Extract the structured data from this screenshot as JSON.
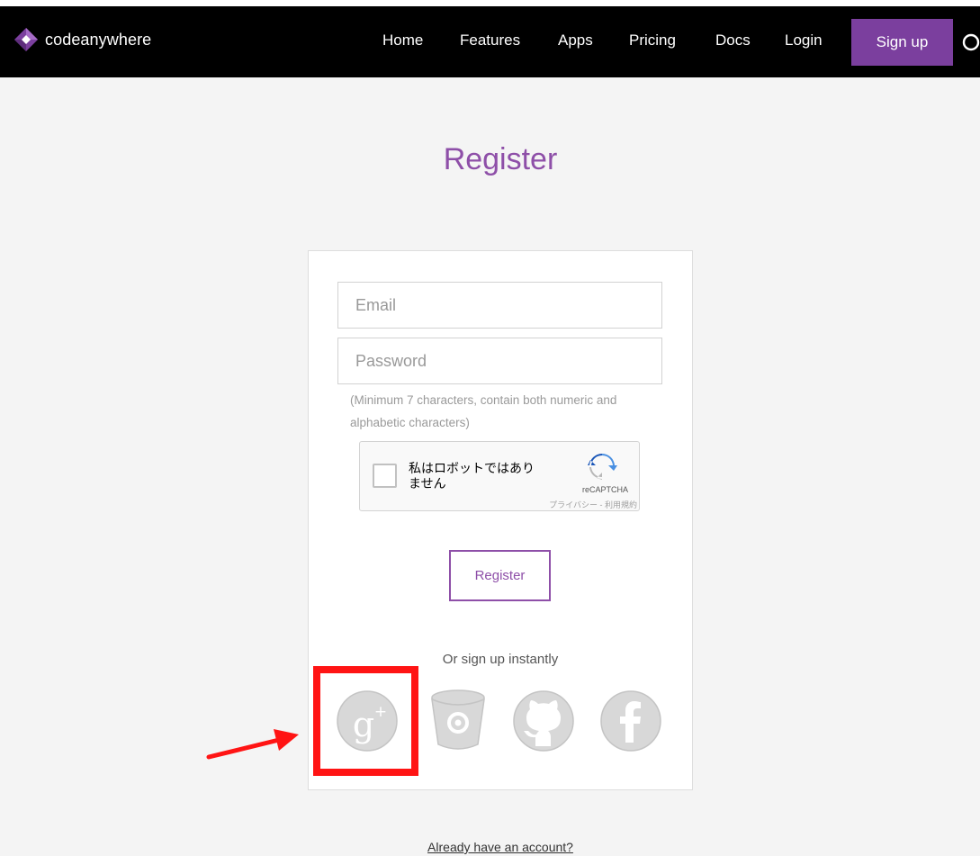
{
  "brand": {
    "name": "codeanywhere",
    "logo_icon": "diamond-logo-icon",
    "accent_color": "#7b3f9e"
  },
  "nav": {
    "items": [
      {
        "label": "Home"
      },
      {
        "label": "Features"
      },
      {
        "label": "Apps"
      },
      {
        "label": "Pricing"
      },
      {
        "label": "Docs"
      },
      {
        "label": "Login"
      }
    ],
    "signup_label": "Sign up",
    "search_icon": "search-icon"
  },
  "page": {
    "title": "Register",
    "title_color": "#8e4fa8"
  },
  "form": {
    "email_placeholder": "Email",
    "password_placeholder": "Password",
    "password_hint": "(Minimum 7 characters, contain both numeric and alphabetic characters)",
    "captcha": {
      "label": "私はロボットではありません",
      "brand": "reCAPTCHA",
      "links": "プライバシー - 利用規約"
    },
    "submit_label": "Register",
    "social_prompt": "Or sign up instantly",
    "social_providers": [
      "google-plus-icon",
      "bitbucket-icon",
      "github-icon",
      "facebook-icon"
    ]
  },
  "footer": {
    "login_link": "Already have an account?"
  },
  "annotation": {
    "highlight_color": "#ff1414"
  }
}
